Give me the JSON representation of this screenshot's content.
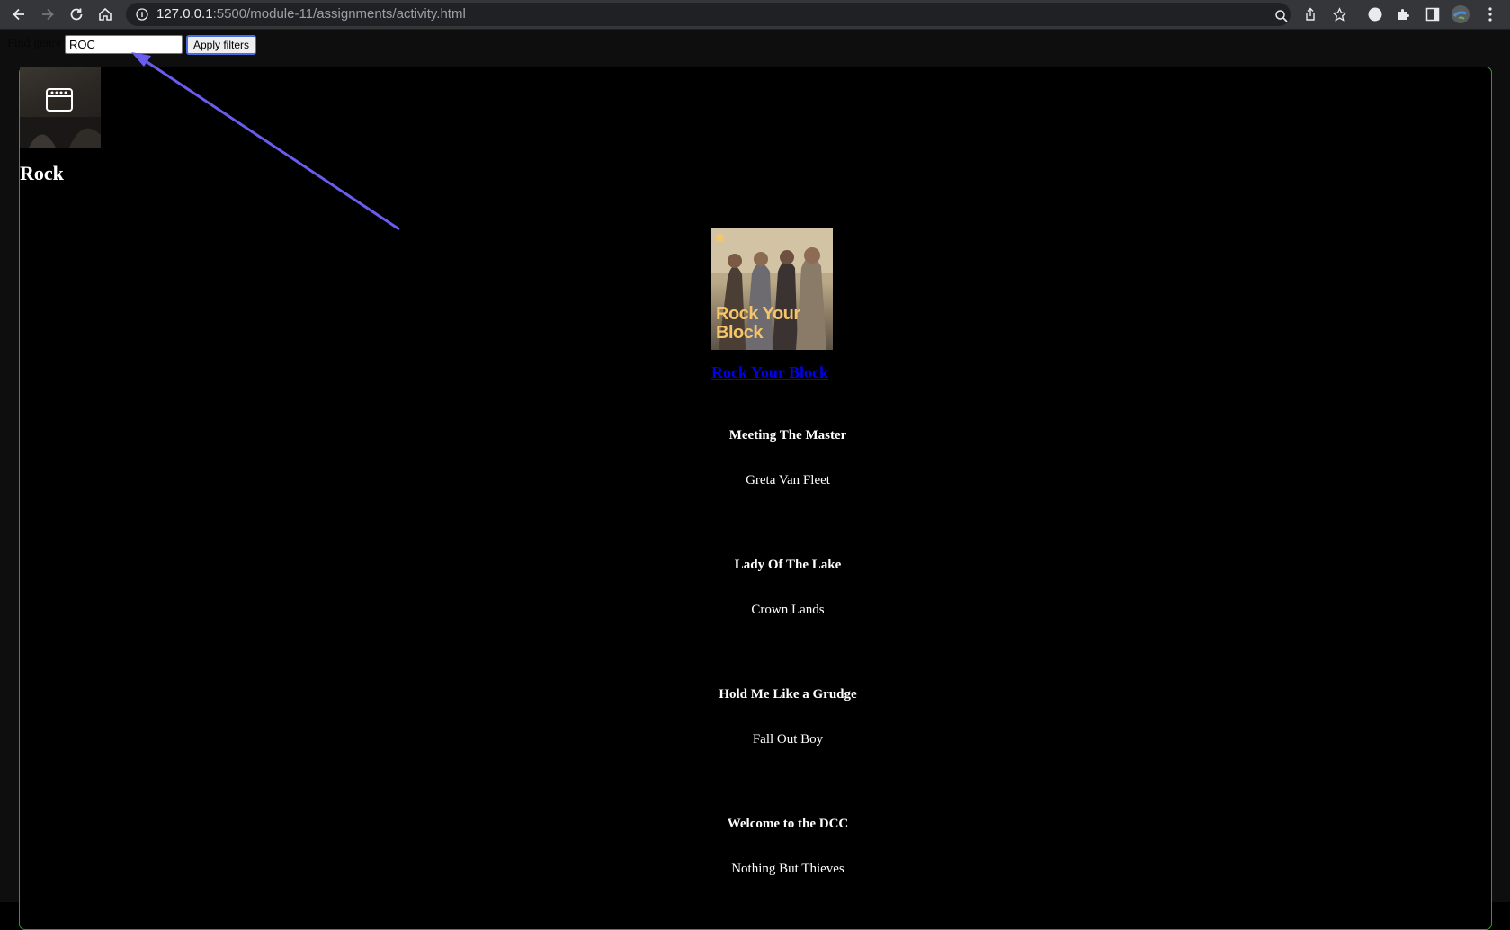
{
  "browser": {
    "url_host": "127.0.0.1",
    "url_rest": ":5500/module-11/assignments/activity.html"
  },
  "filter": {
    "label": "Find genre",
    "value": "ROC",
    "button_label": "Apply filters"
  },
  "genre": {
    "title": "Rock",
    "playlist": {
      "name": "Rock Your Block",
      "cover_text_line1": "Rock Your",
      "cover_text_line2": "Block"
    },
    "tracks": [
      {
        "title": "Meeting The Master",
        "artist": "Greta Van Fleet"
      },
      {
        "title": "Lady Of The Lake",
        "artist": "Crown Lands"
      },
      {
        "title": "Hold Me Like a Grudge",
        "artist": "Fall Out Boy"
      },
      {
        "title": "Welcome to the DCC",
        "artist": "Nothing But Thieves"
      }
    ]
  },
  "colors": {
    "card_border": "#2f9a2f",
    "link": "#0000ee",
    "annotation_arrow": "#6b5cf0"
  }
}
